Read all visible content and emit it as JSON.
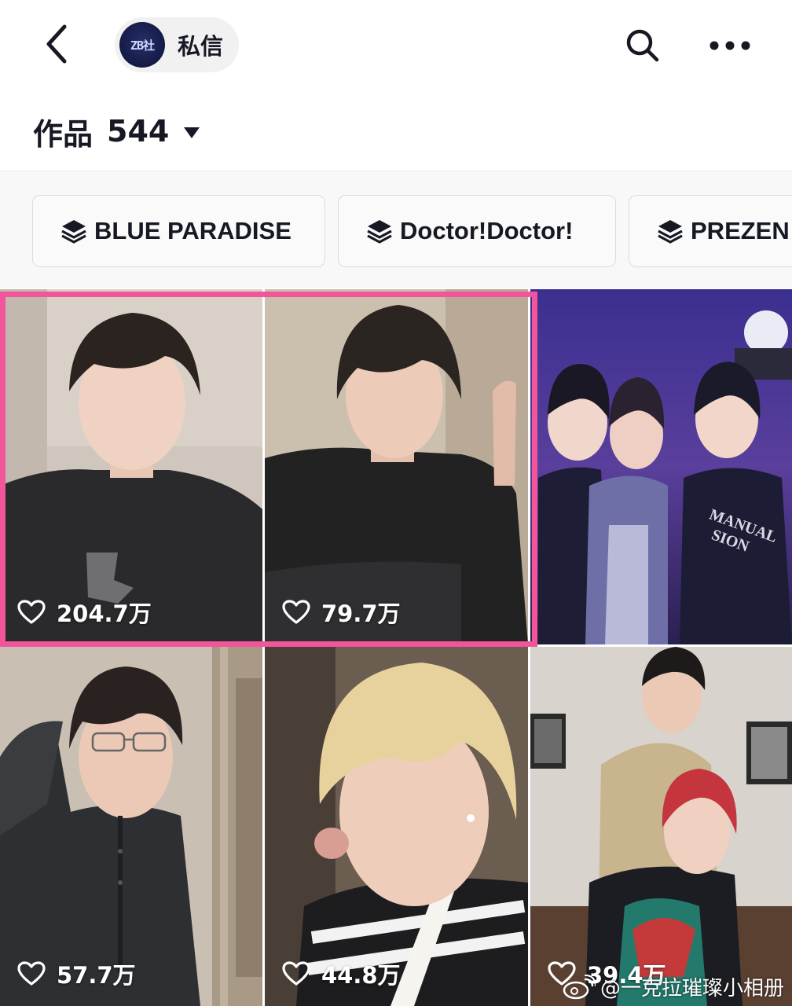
{
  "topbar": {
    "back_icon": "chevron-left-icon",
    "avatar_text": "ZB社",
    "dm_label": "私信",
    "search_icon": "search-icon",
    "more_icon": "more-dots-icon"
  },
  "works": {
    "label": "作品",
    "count": "544",
    "caret_icon": "caret-down-icon"
  },
  "collections": [
    {
      "label": "BLUE PARADISE",
      "icon": "stack-icon"
    },
    {
      "label": "Doctor!Doctor!",
      "icon": "stack-icon"
    },
    {
      "label": "PREZEN",
      "icon": "stack-icon"
    }
  ],
  "videos": [
    {
      "likes": "204.7万"
    },
    {
      "likes": "79.7万"
    },
    {
      "likes": ""
    },
    {
      "likes": "57.7万"
    },
    {
      "likes": "44.8万"
    },
    {
      "likes": "39.4万"
    }
  ],
  "highlight_color": "#f2559a",
  "watermark": {
    "text": "@一克拉璀璨小相册",
    "icon": "weibo-logo-icon"
  }
}
